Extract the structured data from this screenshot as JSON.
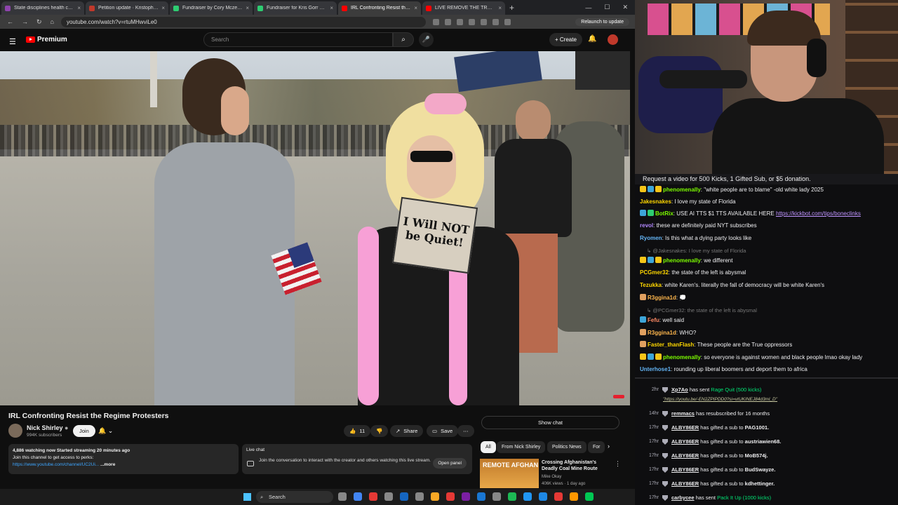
{
  "browser": {
    "tabs": [
      {
        "label": "State disciplines health care pr...",
        "color": "#8e44ad"
      },
      {
        "label": "Petition update · Kristopher's...",
        "color": "#c0392b"
      },
      {
        "label": "Fundraiser by Cory Mczenna...",
        "color": "#2ecc71"
      },
      {
        "label": "Fundraiser for Kris Gorr by Ke...",
        "color": "#2ecc71"
      },
      {
        "label": "IRL Confronting Resist the R...",
        "color": "#ff0000"
      },
      {
        "label": "LIVE REMOVE THE TRUMP RE...",
        "color": "#ff0000"
      }
    ],
    "url": "youtube.com/watch?v=rtuMHwviLe0",
    "relaunch_label": "Relaunch to update"
  },
  "youtube": {
    "logo_text": "Premium",
    "search_placeholder": "Search",
    "create_label": "Create",
    "video": {
      "title": "IRL Confronting Resist the Regime Protesters",
      "sign_text": "I Will NOT be Quiet!",
      "channel": "Nick Shirley",
      "subscribers": "994K subscribers",
      "join_label": "Join",
      "likes": "11",
      "share_label": "Share",
      "save_label": "Save"
    },
    "description": {
      "line1": "4,886 watching now  Started streaming 20 minutes ago",
      "line2": "Join this channel to get access to perks:",
      "link": "https://www.youtube.com/channel/UC2Ui...",
      "more": "...more"
    },
    "live_chat": {
      "title": "Live chat",
      "text": "Join the conversation to interact with the creator and others watching this live stream.",
      "open_label": "Open panel"
    },
    "show_chat_label": "Show chat",
    "chips": [
      "All",
      "From Nick Shirley",
      "Politics News",
      "For y"
    ],
    "recommended": {
      "thumb_text": "REMOTE AFGHAN",
      "title": "Crossing Afghanistan's Deadly Coal Mine Route",
      "channel": "Mike Okay",
      "meta": "406K views · 1 day ago"
    }
  },
  "stream_chat": {
    "alert": "Request a video for 500 Kicks, 1 Gifted Sub, or $5 donation.",
    "messages": [
      {
        "user": "phenomenally",
        "color": "#7cfc00",
        "text": " \"white people are to blame\" -old white lady 2025",
        "badges": [
          "#f5c518",
          "#3da5d9",
          "#f5c518"
        ]
      },
      {
        "user": "Jakesnakes",
        "color": "#ffd700",
        "text": " I love my state of Florida",
        "badges": []
      },
      {
        "user": "BotRix",
        "color": "#7cfc00",
        "text": " USE AI TTS $1 TTS AVAILABLE HERE ",
        "link": "https://kickbot.com/tips/boneclinks",
        "badges": [
          "#3da5d9",
          "#2ecc71"
        ]
      },
      {
        "user": "revol",
        "color": "#b388ff",
        "text": " these are definitely paid NYT subscribes",
        "badges": []
      },
      {
        "user": "Ryomen",
        "color": "#64b5f6",
        "text": " Is this what a dying party looks like",
        "badges": []
      },
      {
        "reply": "@Jakesnakes: I love my state of Florida"
      },
      {
        "user": "phenomenally",
        "color": "#7cfc00",
        "text": " we different",
        "badges": [
          "#f5c518",
          "#3da5d9",
          "#f5c518"
        ]
      },
      {
        "user": "PCGmer32",
        "color": "#ffd700",
        "text": " the state of the left is abysmal",
        "badges": []
      },
      {
        "user": "Tezukka",
        "color": "#ffd700",
        "text": " white Karen's. literally the fall of democracy will be white Karen's",
        "badges": []
      },
      {
        "user": "R3ggina1d",
        "color": "#ffb74d",
        "text": " 💭",
        "badges": [
          "#e0a060"
        ]
      },
      {
        "reply": "@PCGmer32: the state of the left is abysmal"
      },
      {
        "user": "Fefu",
        "color": "#ff8a65",
        "text": " well said",
        "badges": [
          "#3da5d9"
        ]
      },
      {
        "user": "R3ggina1d",
        "color": "#ffb74d",
        "text": " WHO?",
        "badges": [
          "#e0a060"
        ]
      },
      {
        "user": "Faster_thanFlash",
        "color": "#ffd700",
        "text": " These people are the True oppressors",
        "badges": [
          "#e0a060"
        ]
      },
      {
        "user": "phenomenally",
        "color": "#7cfc00",
        "text": " so everyone is against women and black people lmao okay lady",
        "badges": [
          "#f5c518",
          "#3da5d9",
          "#f5c518"
        ]
      },
      {
        "user": "Unterhose1",
        "color": "#64b5f6",
        "text": " rounding up liberal boomers and deport them to africa",
        "badges": []
      }
    ],
    "events": [
      {
        "time": "2hr",
        "name": "Xp7Ao",
        "action": " has sent ",
        "gift": "Rage Quit (500 kicks)",
        "sublink": "\"https://youtu.be/-EN2ZPIPDD0?si=vtUKINEJ84d3ml_D\""
      },
      {
        "time": "14hr",
        "name": "remmacs",
        "action": " has resubscribed for 16 months"
      },
      {
        "time": "17hr",
        "name": "ALBY86ER",
        "action": " has gifted a sub to ",
        "target": "PAG1001."
      },
      {
        "time": "17hr",
        "name": "ALBY86ER",
        "action": " has gifted a sub to ",
        "target": "austriawien68."
      },
      {
        "time": "17hr",
        "name": "ALBY86ER",
        "action": " has gifted a sub to ",
        "target": "MoB574j."
      },
      {
        "time": "17hr",
        "name": "ALBY86ER",
        "action": " has gifted a sub to ",
        "target": "BudSwayze."
      },
      {
        "time": "17hr",
        "name": "ALBY86ER",
        "action": " has gifted a sub to ",
        "target": "kdhettinger."
      },
      {
        "time": "17hr",
        "name": "carbycee",
        "action": " has sent ",
        "gift": "Pack It Up (1000 kicks)"
      }
    ]
  },
  "taskbar": {
    "search_label": "Search",
    "icons": [
      "#888888",
      "#4285f4",
      "#e53935",
      "#888888",
      "#1565c0",
      "#888888",
      "#f9a825",
      "#e53935",
      "#7b1fa2",
      "#1976d2",
      "#888888",
      "#1db954",
      "#2196f3",
      "#1e88e5",
      "#e53935",
      "#ff9800",
      "#00c853"
    ]
  }
}
